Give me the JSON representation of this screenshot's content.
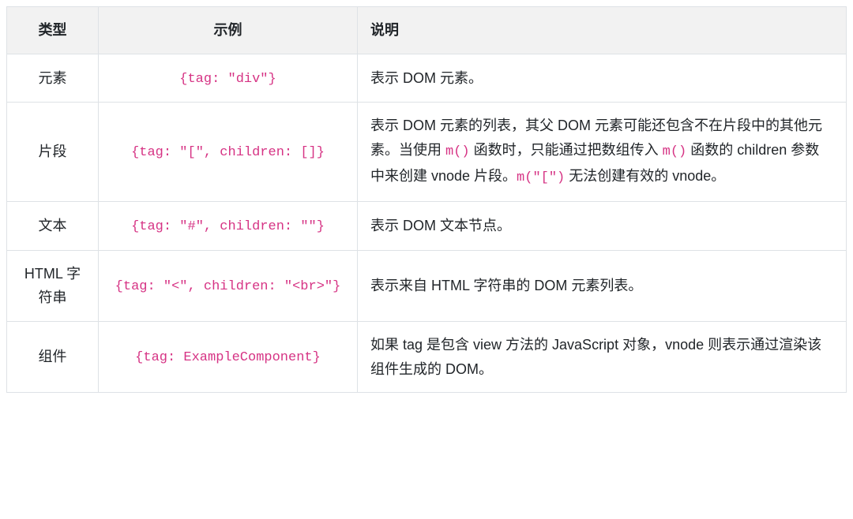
{
  "headers": {
    "type": "类型",
    "example": "示例",
    "description": "说明"
  },
  "rows": [
    {
      "type": "元素",
      "example_code": "{tag: \"div\"}",
      "desc": {
        "kind": "plain",
        "text": "表示 DOM 元素。"
      }
    },
    {
      "type": "片段",
      "example_code": "{tag: \"[\", children: []}",
      "desc": {
        "kind": "rich",
        "parts": [
          {
            "t": "text",
            "v": "表示 DOM 元素的列表，其父 DOM 元素可能还包含不在片段中的其他元素。当使用 "
          },
          {
            "t": "code",
            "v": "m()"
          },
          {
            "t": "text",
            "v": " 函数时，只能通过把数组传入 "
          },
          {
            "t": "code",
            "v": "m()"
          },
          {
            "t": "text",
            "v": " 函数的 children 参数中来创建 vnode 片段。"
          },
          {
            "t": "code",
            "v": "m(\"[\")"
          },
          {
            "t": "text",
            "v": " 无法创建有效的 vnode。"
          }
        ]
      }
    },
    {
      "type": "文本",
      "example_code": "{tag: \"#\", children: \"\"}",
      "desc": {
        "kind": "plain",
        "text": "表示 DOM 文本节点。"
      }
    },
    {
      "type": "HTML 字符串",
      "example_code": "{tag: \"<\", children: \"<br>\"}",
      "desc": {
        "kind": "plain",
        "text": "表示来自 HTML 字符串的 DOM 元素列表。"
      }
    },
    {
      "type": "组件",
      "example_code": "{tag: ExampleComponent}",
      "desc": {
        "kind": "plain",
        "text": "如果 tag 是包含 view 方法的 JavaScript 对象，vnode 则表示通过渲染该组件生成的 DOM。"
      }
    }
  ]
}
